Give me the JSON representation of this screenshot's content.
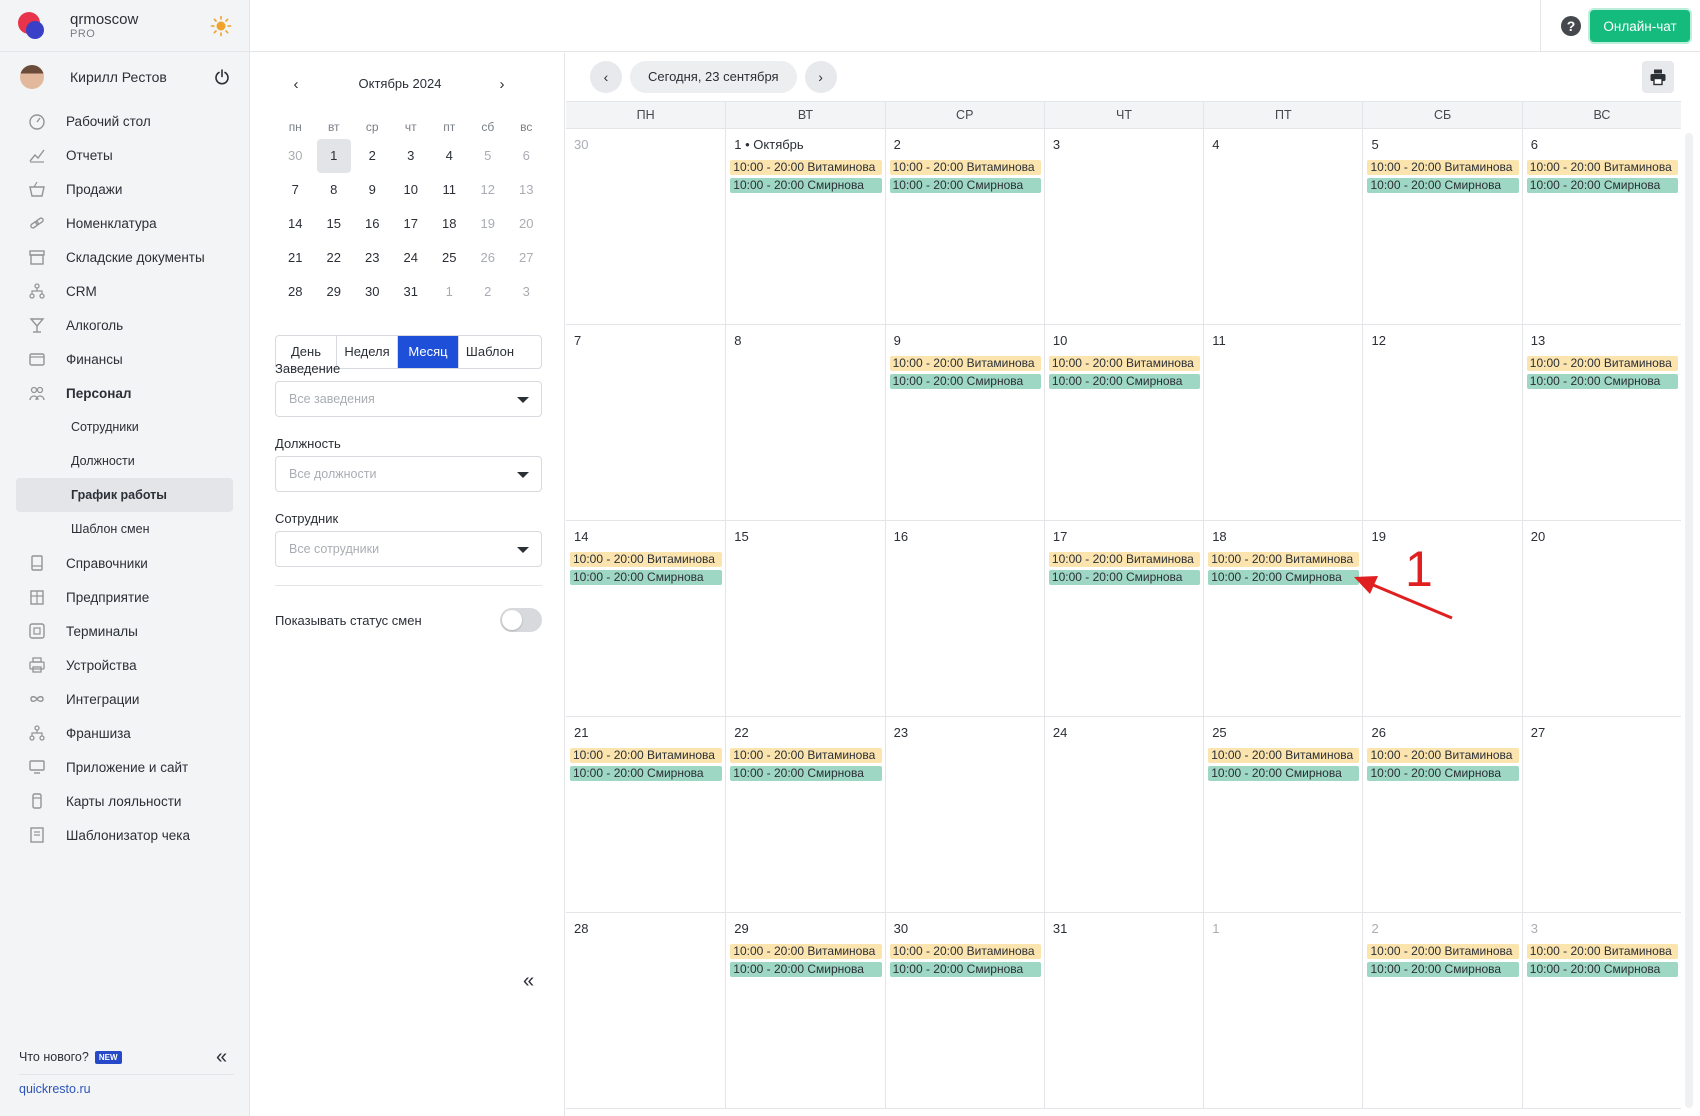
{
  "brand": {
    "name": "qrmoscow",
    "plan": "PRO"
  },
  "user": {
    "name": "Кирилл Рестов"
  },
  "nav": [
    {
      "label": "Рабочий стол",
      "icon": "gauge-icon"
    },
    {
      "label": "Отчеты",
      "icon": "chart-icon"
    },
    {
      "label": "Продажи",
      "icon": "basket-icon"
    },
    {
      "label": "Номенклатура",
      "icon": "link-icon"
    },
    {
      "label": "Складские документы",
      "icon": "archive-icon"
    },
    {
      "label": "CRM",
      "icon": "hierarchy-icon"
    },
    {
      "label": "Алкоголь",
      "icon": "cocktail-icon"
    },
    {
      "label": "Финансы",
      "icon": "wallet-icon"
    },
    {
      "label": "Персонал",
      "icon": "people-icon"
    }
  ],
  "personnel_sub": [
    "Сотрудники",
    "Должности",
    "График работы",
    "Шаблон смен"
  ],
  "nav_after": [
    {
      "label": "Справочники",
      "icon": "book-icon"
    },
    {
      "label": "Предприятие",
      "icon": "building-icon"
    },
    {
      "label": "Терминалы",
      "icon": "qr-icon"
    },
    {
      "label": "Устройства",
      "icon": "printer-icon"
    },
    {
      "label": "Интеграции",
      "icon": "infinity-icon"
    },
    {
      "label": "Франшиза",
      "icon": "hierarchy-icon"
    },
    {
      "label": "Приложение и сайт",
      "icon": "monitor-icon"
    },
    {
      "label": "Карты лояльности",
      "icon": "card-icon"
    },
    {
      "label": "Шаблонизатор чека",
      "icon": "receipt-icon"
    }
  ],
  "footer": {
    "whats_new": "Что нового?",
    "badge": "NEW",
    "link": "quickresto.ru"
  },
  "topbar": {
    "help": "?",
    "chat_button": "Онлайн-чат"
  },
  "mini_calendar": {
    "title": "Октябрь 2024",
    "weekdays": [
      "пн",
      "вт",
      "ср",
      "чт",
      "пт",
      "сб",
      "вс"
    ],
    "weeks": [
      [
        "30",
        "1",
        "2",
        "3",
        "4",
        "5",
        "6"
      ],
      [
        "7",
        "8",
        "9",
        "10",
        "11",
        "12",
        "13"
      ],
      [
        "14",
        "15",
        "16",
        "17",
        "18",
        "19",
        "20"
      ],
      [
        "21",
        "22",
        "23",
        "24",
        "25",
        "26",
        "27"
      ],
      [
        "28",
        "29",
        "30",
        "31",
        "1",
        "2",
        "3"
      ]
    ],
    "selected": "1"
  },
  "view_modes": [
    "День",
    "Неделя",
    "Месяц",
    "Шаблон"
  ],
  "active_view": "Месяц",
  "filters": {
    "venue": {
      "label": "Заведение",
      "placeholder": "Все заведения"
    },
    "position": {
      "label": "Должность",
      "placeholder": "Все должности"
    },
    "employee": {
      "label": "Сотрудник",
      "placeholder": "Все сотрудники"
    },
    "show_status": {
      "label": "Показывать статус смен",
      "on": false
    }
  },
  "calendar": {
    "today_label": "Сегодня, 23 сентября",
    "weekdays": [
      "ПН",
      "ВТ",
      "СР",
      "ЧТ",
      "ПТ",
      "СБ",
      "ВС"
    ],
    "shift_a": "10:00 - 20:00 Витаминова",
    "shift_b": "10:00 - 20:00 Смирнова",
    "days": [
      {
        "n": "30",
        "muted": true,
        "shifts": false
      },
      {
        "n": "1 • Октябрь",
        "shifts": true
      },
      {
        "n": "2",
        "shifts": true
      },
      {
        "n": "3",
        "shifts": false
      },
      {
        "n": "4",
        "shifts": false
      },
      {
        "n": "5",
        "shifts": true
      },
      {
        "n": "6",
        "shifts": true
      },
      {
        "n": "7",
        "shifts": false
      },
      {
        "n": "8",
        "shifts": false
      },
      {
        "n": "9",
        "shifts": true
      },
      {
        "n": "10",
        "shifts": true
      },
      {
        "n": "11",
        "shifts": false
      },
      {
        "n": "12",
        "shifts": false
      },
      {
        "n": "13",
        "shifts": true
      },
      {
        "n": "14",
        "shifts": true
      },
      {
        "n": "15",
        "shifts": false
      },
      {
        "n": "16",
        "shifts": false
      },
      {
        "n": "17",
        "shifts": true
      },
      {
        "n": "18",
        "shifts": true
      },
      {
        "n": "19",
        "shifts": false
      },
      {
        "n": "20",
        "shifts": false
      },
      {
        "n": "21",
        "shifts": true
      },
      {
        "n": "22",
        "shifts": true
      },
      {
        "n": "23",
        "shifts": false
      },
      {
        "n": "24",
        "shifts": false
      },
      {
        "n": "25",
        "shifts": true
      },
      {
        "n": "26",
        "shifts": true
      },
      {
        "n": "27",
        "shifts": false
      },
      {
        "n": "28",
        "shifts": false
      },
      {
        "n": "29",
        "shifts": true
      },
      {
        "n": "30",
        "shifts": true
      },
      {
        "n": "31",
        "shifts": false
      },
      {
        "n": "1",
        "muted": true,
        "shifts": false
      },
      {
        "n": "2",
        "muted": true,
        "shifts": true
      },
      {
        "n": "3",
        "muted": true,
        "shifts": true
      }
    ]
  },
  "annotation": {
    "label": "1"
  },
  "colors": {
    "accent": "#1d4fd8",
    "chat": "#14bb7d",
    "shift_a": "#fbe4ae",
    "shift_b": "#9ed7c3",
    "annotation": "#e02020"
  }
}
